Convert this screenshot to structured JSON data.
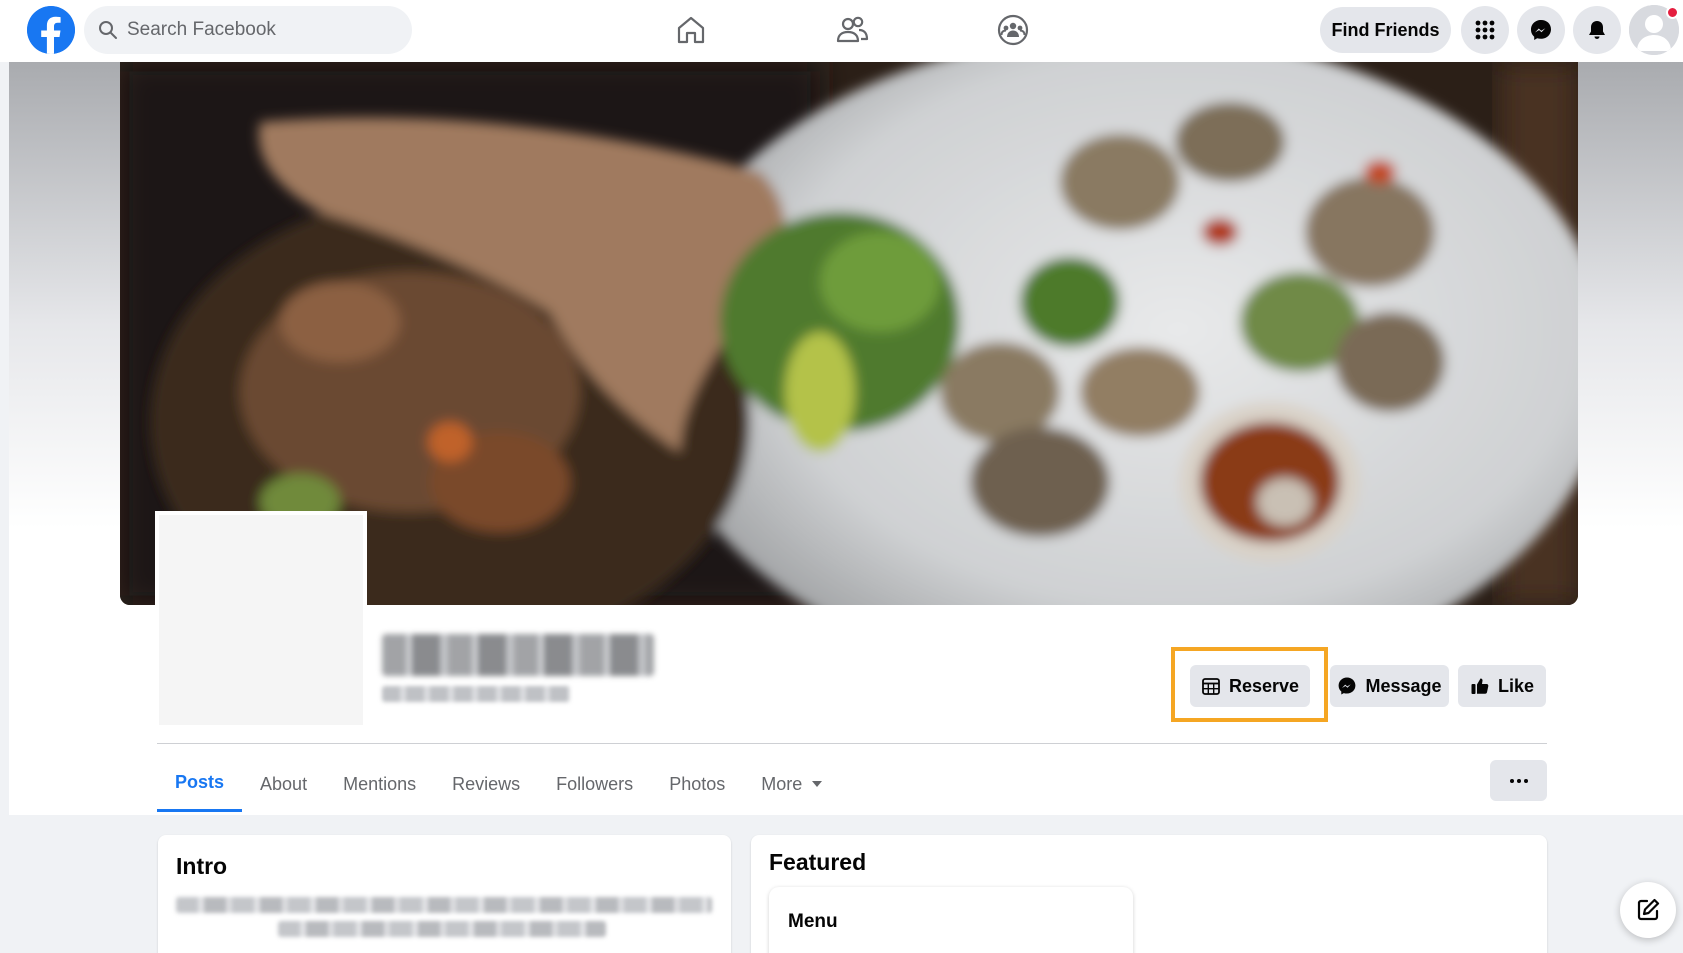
{
  "nav": {
    "search_placeholder": "Search Facebook",
    "find_friends_label": "Find Friends",
    "icons": [
      "facebook-logo",
      "search-icon",
      "home-icon",
      "friends-icon",
      "groups-icon",
      "menu-grid-icon",
      "messenger-icon",
      "notifications-icon",
      "account-avatar"
    ]
  },
  "actions": {
    "reserve_label": "Reserve",
    "message_label": "Message",
    "like_label": "Like"
  },
  "tabs": [
    {
      "label": "Posts"
    },
    {
      "label": "About"
    },
    {
      "label": "Mentions"
    },
    {
      "label": "Reviews"
    },
    {
      "label": "Followers"
    },
    {
      "label": "Photos"
    },
    {
      "label": "More"
    }
  ],
  "intro": {
    "title": "Intro"
  },
  "featured": {
    "title": "Featured",
    "menu_label": "Menu"
  },
  "colors": {
    "brand": "#1877f2",
    "highlight": "#f5a623",
    "button_bg": "#e4e6eb",
    "page_bg": "#f0f2f5"
  }
}
